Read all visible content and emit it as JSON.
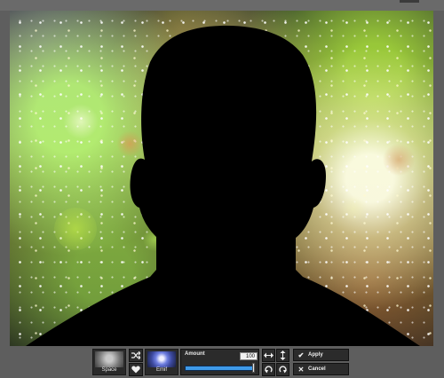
{
  "editor": {
    "image": "galaxy background with head-and-shoulders silhouette"
  },
  "toolbar": {
    "thumbnails": [
      {
        "label": "Space",
        "icon": "space-preset-thumbnail"
      },
      {
        "label": "Emif",
        "icon": "emif-preset-thumbnail"
      }
    ],
    "shuffle_icon": "shuffle-icon",
    "favorite_icon": "heart-icon",
    "amount": {
      "label": "Amount",
      "value": "100",
      "level_percent": 100
    },
    "flip_horizontal_icon": "flip-horizontal-icon",
    "flip_vertical_icon": "flip-vertical-icon",
    "rotate_left_icon": "rotate-left-icon",
    "rotate_right_icon": "rotate-right-icon",
    "apply": {
      "label": "Apply",
      "icon": "checkmark-icon"
    },
    "cancel": {
      "label": "Cancel",
      "icon": "close-icon"
    }
  },
  "colors": {
    "background": "#5e5e5e",
    "toolbar_button": "#2b2b2b",
    "slider_blue": "#3f9ae8"
  }
}
